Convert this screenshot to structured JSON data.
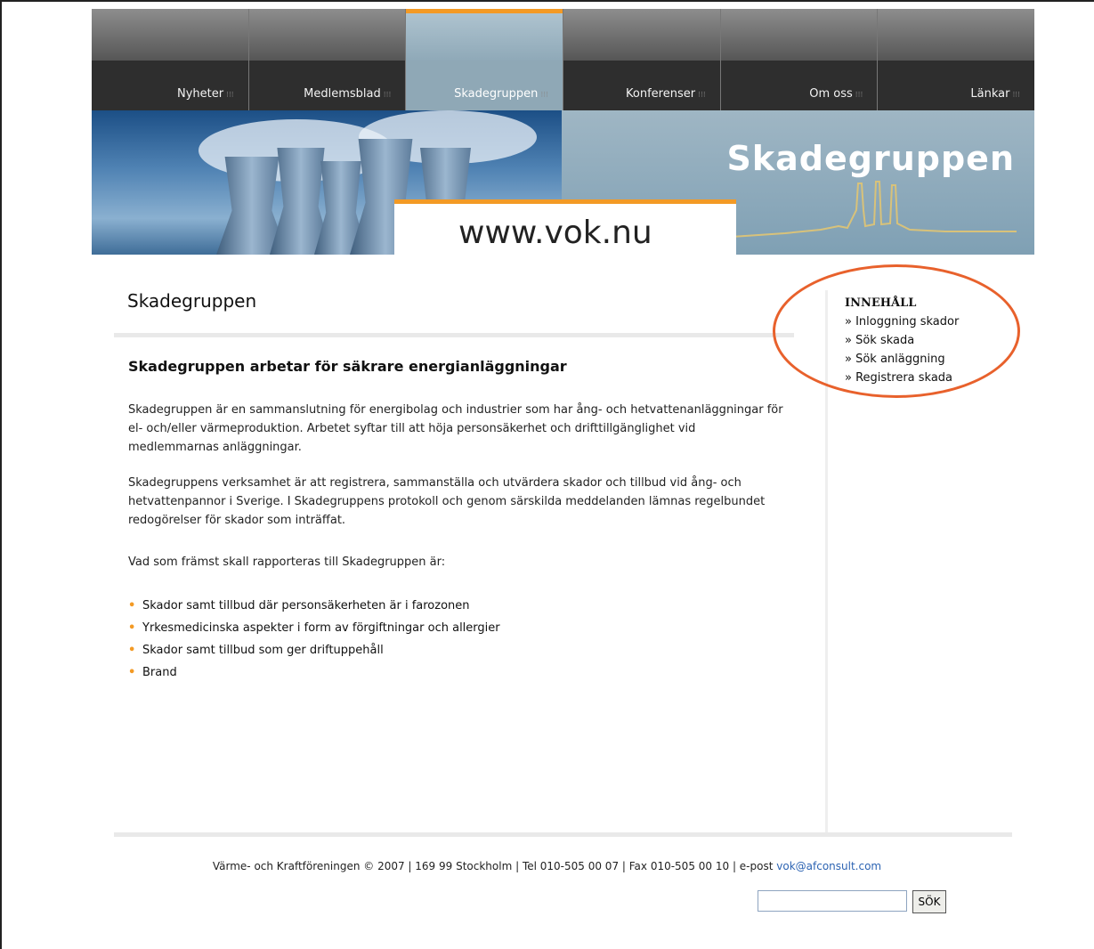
{
  "nav": {
    "tabs": [
      {
        "label": "Nyheter",
        "active": false
      },
      {
        "label": "Medlemsblad",
        "active": false
      },
      {
        "label": "Skadegruppen",
        "active": true
      },
      {
        "label": "Konferenser",
        "active": false
      },
      {
        "label": "Om oss",
        "active": false
      },
      {
        "label": "Länkar",
        "active": false
      }
    ],
    "separator": "⁝⁝⁝"
  },
  "banner": {
    "url": "www.vok.nu",
    "title": "Skadegruppen"
  },
  "main": {
    "page_title": "Skadegruppen",
    "heading": "Skadegruppen arbetar för säkrare energianläggningar",
    "paragraphs": [
      "Skadegruppen är en sammanslutning för energibolag och industrier som har ång- och hetvattenanläggningar för el- och/eller värmeproduktion. Arbetet syftar till att höja personsäkerhet och drifttillgänglighet vid medlemmarnas anläggningar.",
      "Skadegruppens verksamhet är att registrera, sammanställa och utvärdera skador och tillbud vid ång- och hetvattenpannor i Sverige. I Skadegruppens protokoll och genom särskilda meddelanden lämnas regelbundet redogörelser för skador som inträffat.",
      "Vad som främst skall rapporteras till Skadegruppen är:"
    ],
    "bullet_mark": "•",
    "bullets": [
      "Skador samt tillbud där personsäkerheten är i farozonen",
      "Yrkesmedicinska aspekter i form av förgiftningar och allergier",
      "Skador samt tillbud som ger driftuppehåll",
      "Brand"
    ]
  },
  "sidebar": {
    "heading": "INNEHÅLL",
    "links": [
      "» Inloggning skador",
      "» Sök skada",
      "» Sök anläggning",
      "» Registrera skada"
    ]
  },
  "footer": {
    "text": "Värme- och Kraftföreningen © 2007 | 169 99 Stockholm | Tel 010-505 00 07 | Fax 010-505 00 10 | e-post ",
    "email": "vok@afconsult.com",
    "search_value": "",
    "search_button": "SÖK"
  },
  "colors": {
    "accent": "#f39a25",
    "highlight_circle": "#e8612c",
    "link": "#2d64b3"
  }
}
